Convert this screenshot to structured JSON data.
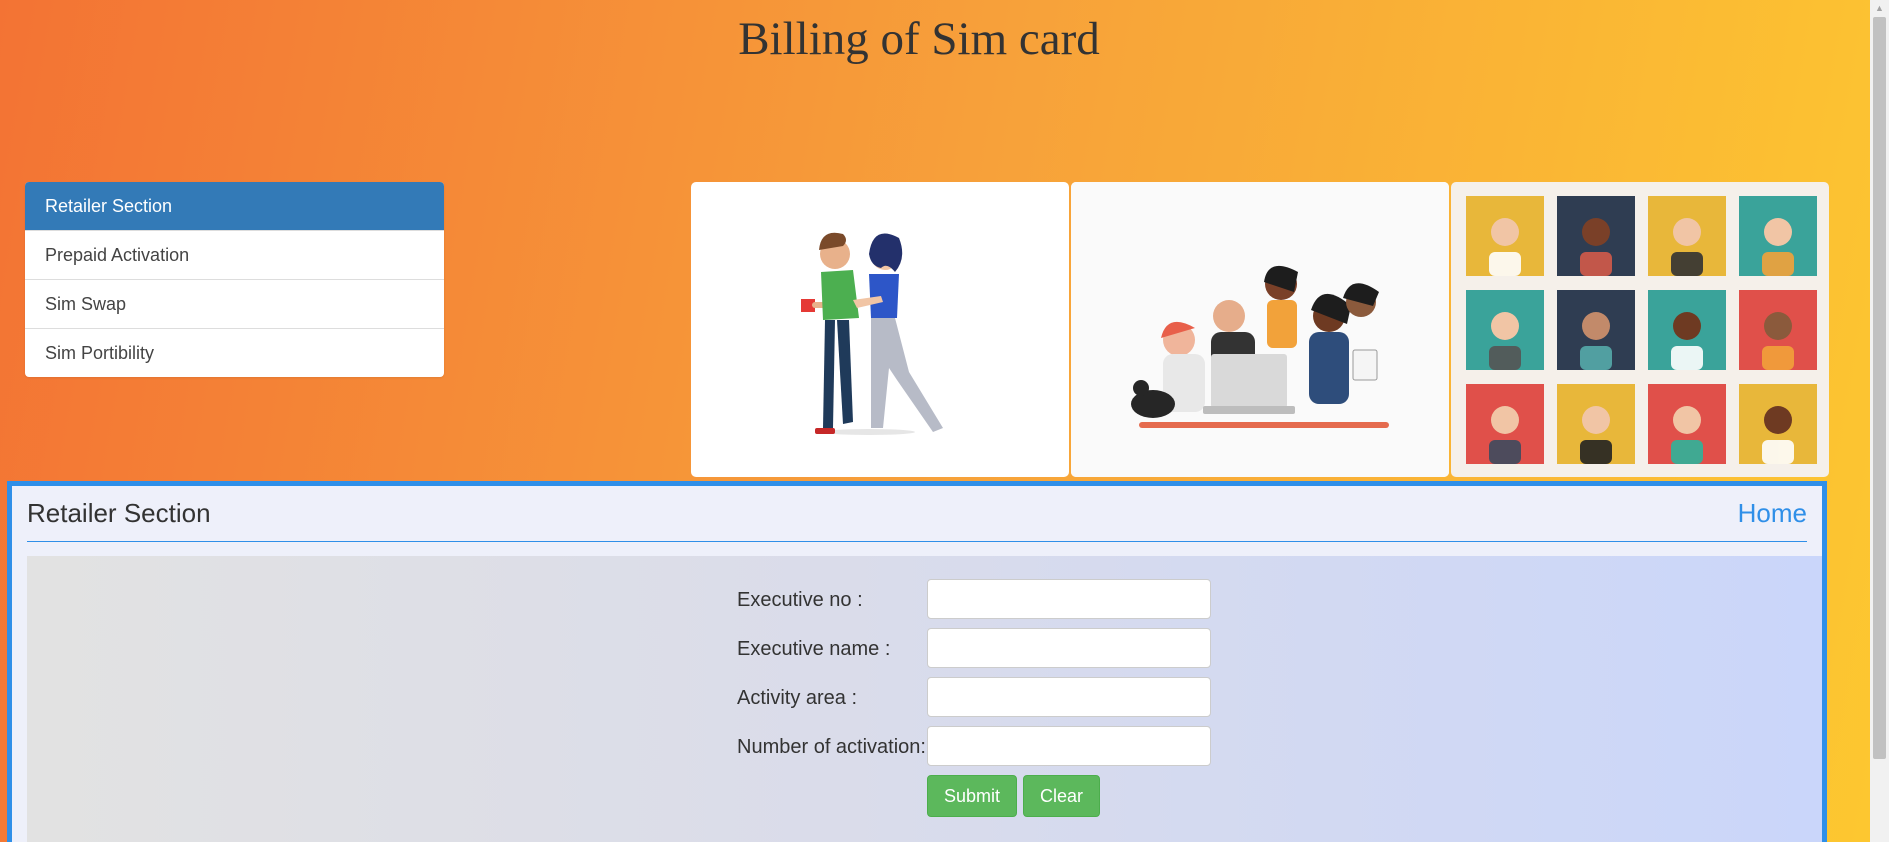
{
  "page": {
    "title": "Billing of Sim card"
  },
  "menu": {
    "items": [
      {
        "label": "Retailer Section"
      },
      {
        "label": "Prepaid Activation"
      },
      {
        "label": "Sim Swap"
      },
      {
        "label": "Sim Portibility"
      }
    ]
  },
  "gallery": {
    "images": [
      {
        "icon": "couple-walking-illustration"
      },
      {
        "icon": "team-at-laptop-illustration"
      },
      {
        "icon": "avatar-grid-illustration"
      }
    ]
  },
  "panel": {
    "title": "Retailer Section",
    "home_label": "Home"
  },
  "form": {
    "fields": [
      {
        "label": "Executive no :",
        "value": ""
      },
      {
        "label": "Executive name :",
        "value": ""
      },
      {
        "label": "Activity area :",
        "value": ""
      },
      {
        "label": "Number of activation:",
        "value": ""
      }
    ],
    "submit_label": "Submit",
    "clear_label": "Clear"
  },
  "colors": {
    "accent": "#337ab7",
    "panel_border": "#2f8fe8",
    "button": "#5cb85c",
    "gradient_start": "#f37334",
    "gradient_end": "#fdc830"
  }
}
